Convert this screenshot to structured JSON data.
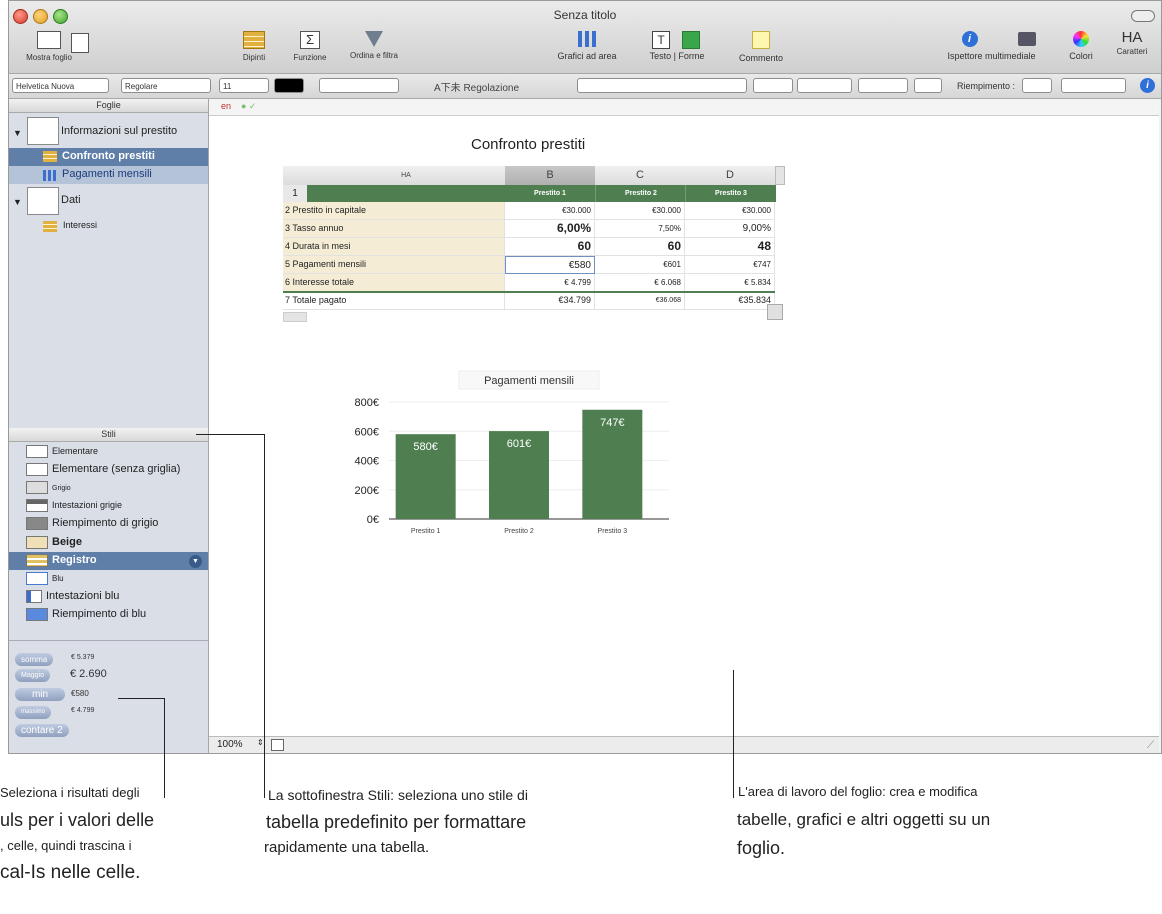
{
  "window": {
    "title": "Senza titolo"
  },
  "toolbar": {
    "show_sheet": "Mostra foglio",
    "dipinti": "Dipinti",
    "funzione": "Funzione",
    "ordina": "Ordina e filtra",
    "grafici": "Grafici ad area",
    "testo_forme": "Testo | Forme",
    "commento": "Commento",
    "ispettore": "Ispettore multimediale",
    "colori": "Colori",
    "caratteri_glyph": "HA",
    "caratteri": "Caratteri"
  },
  "formatbar": {
    "font": "Helvetica Nuova",
    "style": "Regolare",
    "size": "11",
    "wrap": "A下未 Regolazione",
    "riempimento": "Riempimento :"
  },
  "sidebar": {
    "fogli_header": "Foglie",
    "sheets": [
      {
        "label": "Informazioni sul prestito"
      },
      {
        "label": "Confronto prestiti"
      },
      {
        "label": "Pagamenti mensili"
      },
      {
        "label": "Dati"
      },
      {
        "label": "Interessi"
      }
    ],
    "stili_header": "Stili",
    "styles": [
      {
        "label": "Elementare"
      },
      {
        "label": "Elementare (senza griglia)"
      },
      {
        "label": "Grigio"
      },
      {
        "label": "Intestazioni grigie"
      },
      {
        "label": "Riempimento di grigio"
      },
      {
        "label": "Beige"
      },
      {
        "label": "Registro"
      },
      {
        "label": "Blu"
      },
      {
        "label": "Intestazioni blu"
      },
      {
        "label": "Riempimento di blu"
      }
    ],
    "formulas": [
      {
        "label": "somma",
        "value": "€ 5.379"
      },
      {
        "label": "Maggio",
        "value": "€ 2.690"
      },
      {
        "label": "min",
        "value": "€580"
      },
      {
        "label": "massimo",
        "value": "€ 4.799"
      },
      {
        "label": "contare 2",
        "value": ""
      }
    ]
  },
  "canvas": {
    "lang": "en",
    "zoom": "100%",
    "table_title": "Confronto prestiti",
    "columns": [
      "HA",
      "B",
      "C",
      "D"
    ],
    "header_row": [
      "1",
      "",
      "Prestito 1",
      "Prestito 2",
      "Prestito 3"
    ],
    "rows": [
      {
        "label": "2 Prestito in capitale",
        "v": [
          "€30.000",
          "€30.000",
          "€30.000"
        ]
      },
      {
        "label": "3 Tasso annuo",
        "v": [
          "6,00%",
          "7,50%",
          "9,00%"
        ]
      },
      {
        "label": "4 Durata in mesi",
        "v": [
          "60",
          "60",
          "48"
        ]
      },
      {
        "label": "5 Pagamenti mensili",
        "v": [
          "€580",
          "€601",
          "€747"
        ]
      },
      {
        "label": "6 Interesse totale",
        "v": [
          "€ 4.799",
          "€ 6.068",
          "€ 5.834"
        ]
      },
      {
        "label": "7 Totale pagato",
        "v": [
          "€34.799",
          "€36.068",
          "€35.834"
        ]
      }
    ]
  },
  "chart_data": {
    "type": "bar",
    "title": "Pagamenti mensili",
    "categories": [
      "Prestito 1",
      "Prestito 2",
      "Prestito 3"
    ],
    "values": [
      580,
      601,
      747
    ],
    "value_labels": [
      "580€",
      "601€",
      "747€"
    ],
    "y_ticks": [
      "0€",
      "200€",
      "400€",
      "600€",
      "800€"
    ],
    "ylim": [
      0,
      800
    ],
    "color": "#4f7f50",
    "grid": true
  },
  "annotations": {
    "left": [
      "Seleziona i risultati degli",
      "uls per i valori delle",
      ", celle, quindi trascina i",
      "cal-Is nelle celle."
    ],
    "middle": [
      "La sottofinestra Stili: seleziona uno stile di",
      "tabella predefinito per formattare",
      "rapidamente una tabella."
    ],
    "right": [
      "L'area di lavoro del foglio: crea e modifica",
      "tabelle, grafici e altri oggetti su un",
      "foglio."
    ]
  }
}
